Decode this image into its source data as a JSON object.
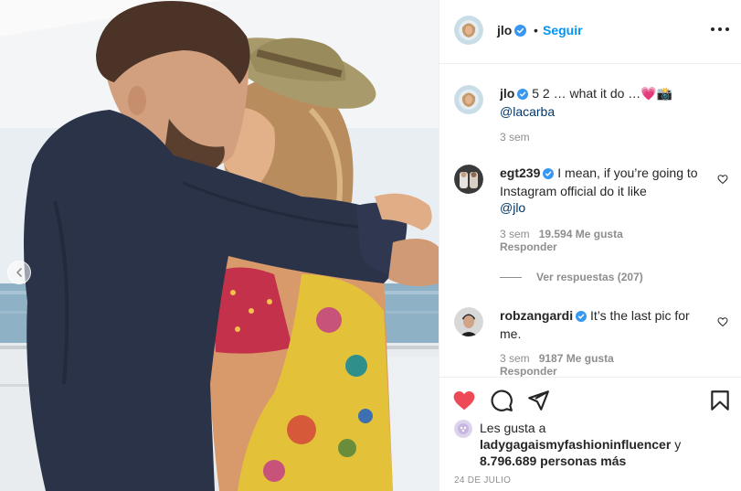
{
  "post": {
    "author": "jlo",
    "follow_label": "Seguir",
    "dot": "•",
    "caption_text": "5 2 … what it do …💗📸",
    "caption_mention": "@lacarba",
    "caption_time": "3 sem"
  },
  "comments": [
    {
      "user": "egt239",
      "text": "I mean, if you’re going to Instagram official do it like",
      "mention": "@jlo",
      "time": "3 sem",
      "likes": "19.594 Me gusta",
      "reply": "Responder",
      "view_replies": "Ver respuestas (207)"
    },
    {
      "user": "robzangardi",
      "text": "It’s the last pic for me.",
      "time": "3 sem",
      "likes": "9187 Me gusta",
      "reply": "Responder"
    }
  ],
  "likes": {
    "prefix": "Les gusta a",
    "user": "ladygagaismyfashioninfluencer",
    "conj": "y",
    "count": "8.796.689 personas más"
  },
  "date": "24 DE JULIO",
  "icons": {
    "heart": "heart-filled-icon",
    "comment": "comment-icon",
    "share": "share-icon",
    "save": "bookmark-icon",
    "more": "more-icon",
    "prev": "chevron-left-icon",
    "verified": "verified-badge-icon"
  },
  "colors": {
    "accent": "#0095f6",
    "like": "#ed4956",
    "text": "#262626",
    "muted": "#8e8e8e",
    "mention": "#00376b"
  }
}
